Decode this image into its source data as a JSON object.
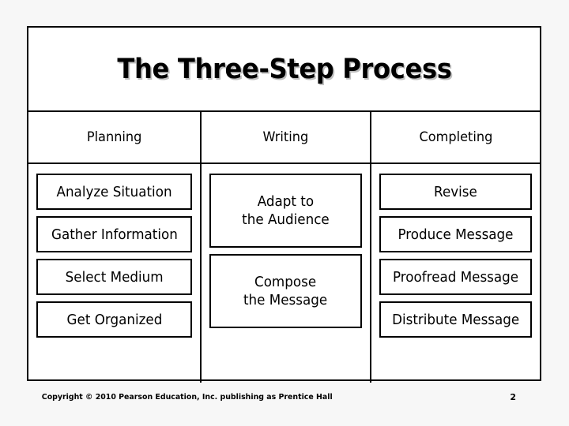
{
  "slide": {
    "title": "The Three-Step Process",
    "background_color": "#ffffff",
    "page_background_color": "#f7f7f7",
    "border_color": "#000000",
    "title_shadow_color": "#bfbfbf"
  },
  "table": {
    "columns": [
      {
        "header": "Planning",
        "steps": [
          {
            "label": "Analyze Situation"
          },
          {
            "label": "Gather Information"
          },
          {
            "label": "Select Medium"
          },
          {
            "label": "Get Organized"
          }
        ]
      },
      {
        "header": "Writing",
        "steps": [
          {
            "line1": "Adapt to",
            "line2": "the Audience"
          },
          {
            "line1": "Compose",
            "line2": "the Message"
          }
        ]
      },
      {
        "header": "Completing",
        "steps": [
          {
            "label": "Revise"
          },
          {
            "label": "Produce Message"
          },
          {
            "label": "Proofread Message"
          },
          {
            "label": "Distribute Message"
          }
        ]
      }
    ]
  },
  "footer": {
    "copyright": "Copyright © 2010 Pearson Education, Inc. publishing as Prentice Hall",
    "page_number": "2"
  }
}
